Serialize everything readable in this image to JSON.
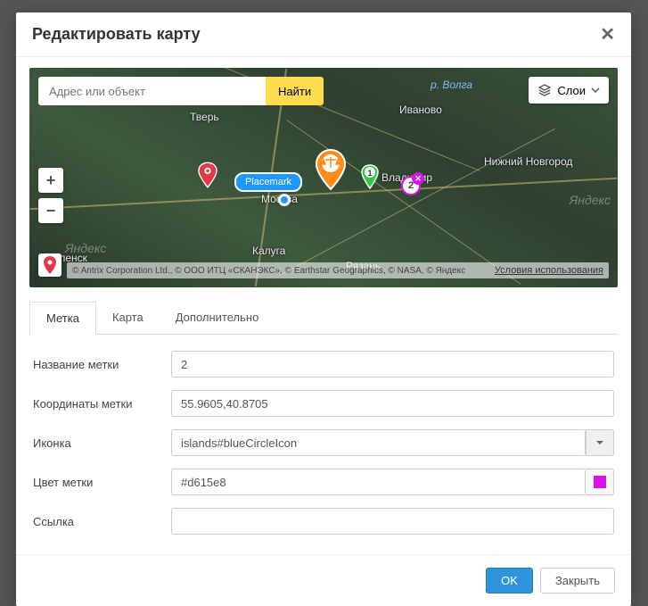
{
  "modal": {
    "title": "Редактировать карту",
    "ok": "OK",
    "close": "Закрыть"
  },
  "map": {
    "search_placeholder": "Адрес или объект",
    "search_btn": "Найти",
    "layers_btn": "Слои",
    "cities": {
      "tver": "Тверь",
      "ivanovo": "Иваново",
      "nnovgorod": "Нижний Новгород",
      "moscow": "Москва",
      "vladimir": "Владимир",
      "kaluga": "Калуга",
      "ryazan": "Рязань",
      "smolensk": "Смоленск"
    },
    "river": "р. Волга",
    "watermark": "Яндекс",
    "attribution": "© Antrix Corporation Ltd., © ООО ИТЦ «СКАНЭКС», © Earthstar Geographics, © NASA, © Яндекс",
    "terms": "Условия использования",
    "placemark_label": "Placemark",
    "pin1_text": "1",
    "pin2_text": "2"
  },
  "tabs": {
    "t1": "Метка",
    "t2": "Карта",
    "t3": "Дополнительно"
  },
  "form": {
    "name_label": "Название метки",
    "name_value": "2",
    "coords_label": "Координаты метки",
    "coords_value": "55.9605,40.8705",
    "icon_label": "Иконка",
    "icon_value": "islands#blueCircleIcon",
    "color_label": "Цвет метки",
    "color_value": "#d615e8",
    "link_label": "Ссылка",
    "link_value": ""
  }
}
